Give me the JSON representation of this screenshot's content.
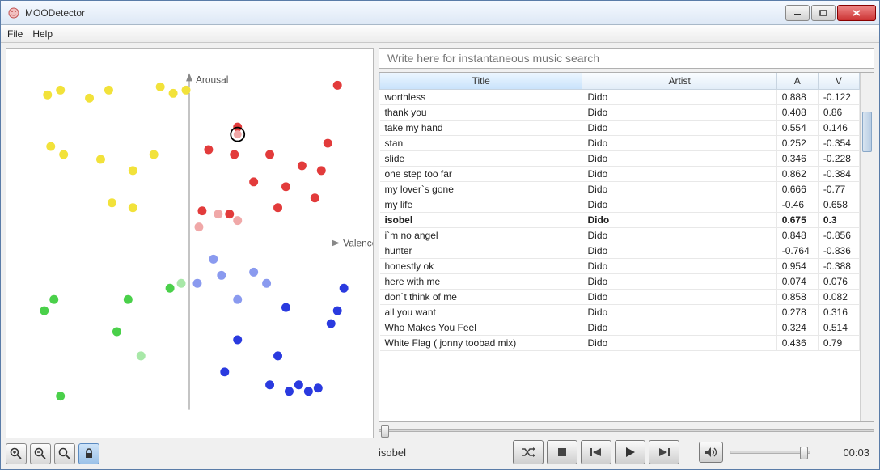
{
  "window": {
    "title": "MOODetector"
  },
  "menubar": {
    "file": "File",
    "help": "Help"
  },
  "search": {
    "placeholder": "Write here for instantaneous music search"
  },
  "columns": {
    "title": "Title",
    "artist": "Artist",
    "a": "A",
    "v": "V"
  },
  "selected_title": "isobel",
  "tracks": [
    {
      "title": "worthless",
      "artist": "Dido",
      "a": 0.888,
      "v": -0.122
    },
    {
      "title": "thank you",
      "artist": "Dido",
      "a": 0.408,
      "v": 0.86
    },
    {
      "title": "take my hand",
      "artist": "Dido",
      "a": 0.554,
      "v": 0.146
    },
    {
      "title": "stan",
      "artist": "Dido",
      "a": 0.252,
      "v": -0.354
    },
    {
      "title": "slide",
      "artist": "Dido",
      "a": 0.346,
      "v": -0.228
    },
    {
      "title": "one step too far",
      "artist": "Dido",
      "a": 0.862,
      "v": -0.384
    },
    {
      "title": "my lover`s gone",
      "artist": "Dido",
      "a": 0.666,
      "v": -0.77
    },
    {
      "title": "my life",
      "artist": "Dido",
      "a": -0.46,
      "v": 0.658
    },
    {
      "title": "isobel",
      "artist": "Dido",
      "a": 0.675,
      "v": 0.3
    },
    {
      "title": "i`m no angel",
      "artist": "Dido",
      "a": 0.848,
      "v": -0.856
    },
    {
      "title": "hunter",
      "artist": "Dido",
      "a": -0.764,
      "v": -0.836
    },
    {
      "title": "honestly ok",
      "artist": "Dido",
      "a": 0.954,
      "v": -0.388
    },
    {
      "title": "here with me",
      "artist": "Dido",
      "a": 0.074,
      "v": 0.076
    },
    {
      "title": "don`t think of me",
      "artist": "Dido",
      "a": 0.858,
      "v": 0.082
    },
    {
      "title": "all you want",
      "artist": "Dido",
      "a": 0.278,
      "v": 0.316
    },
    {
      "title": "Who Makes You Feel",
      "artist": "Dido",
      "a": 0.324,
      "v": 0.514
    },
    {
      "title": "White Flag ( jonny toobad mix)",
      "artist": "Dido",
      "a": 0.436,
      "v": 0.79
    }
  ],
  "player": {
    "now_playing": "isobel",
    "time": "00:03"
  },
  "chart_data": {
    "type": "scatter",
    "title": "",
    "xlabel": "Valence",
    "ylabel": "Arousal",
    "xlim": [
      -1,
      1
    ],
    "ylim": [
      -1,
      1
    ],
    "selected": {
      "x": 0.3,
      "y": 0.675
    },
    "series": [
      {
        "name": "quadrant-2-yellow",
        "color": "#f2e23a",
        "points": [
          {
            "x": -0.88,
            "y": 0.92
          },
          {
            "x": -0.8,
            "y": 0.95
          },
          {
            "x": -0.62,
            "y": 0.9
          },
          {
            "x": -0.5,
            "y": 0.95
          },
          {
            "x": -0.18,
            "y": 0.97
          },
          {
            "x": -0.1,
            "y": 0.93
          },
          {
            "x": -0.02,
            "y": 0.95
          },
          {
            "x": -0.86,
            "y": 0.6
          },
          {
            "x": -0.78,
            "y": 0.55
          },
          {
            "x": -0.55,
            "y": 0.52
          },
          {
            "x": -0.48,
            "y": 0.25
          },
          {
            "x": -0.35,
            "y": 0.45
          },
          {
            "x": -0.35,
            "y": 0.22
          },
          {
            "x": -0.22,
            "y": 0.55
          }
        ]
      },
      {
        "name": "quadrant-1-red",
        "color": "#e23b3b",
        "points": [
          {
            "x": 0.92,
            "y": 0.98
          },
          {
            "x": 0.86,
            "y": 0.62
          },
          {
            "x": 0.82,
            "y": 0.45
          },
          {
            "x": 0.78,
            "y": 0.28
          },
          {
            "x": 0.7,
            "y": 0.48
          },
          {
            "x": 0.6,
            "y": 0.35
          },
          {
            "x": 0.55,
            "y": 0.22
          },
          {
            "x": 0.5,
            "y": 0.55
          },
          {
            "x": 0.4,
            "y": 0.38
          },
          {
            "x": 0.3,
            "y": 0.72
          },
          {
            "x": 0.28,
            "y": 0.55
          },
          {
            "x": 0.25,
            "y": 0.18
          },
          {
            "x": 0.12,
            "y": 0.58
          },
          {
            "x": 0.08,
            "y": 0.2
          }
        ]
      },
      {
        "name": "quadrant-1-red-light",
        "color": "#f0a8a8",
        "points": [
          {
            "x": 0.3,
            "y": 0.14
          },
          {
            "x": 0.18,
            "y": 0.18
          },
          {
            "x": 0.06,
            "y": 0.1
          }
        ]
      },
      {
        "name": "quadrant-3-green",
        "color": "#4ad04a",
        "points": [
          {
            "x": -0.9,
            "y": -0.42
          },
          {
            "x": -0.84,
            "y": -0.35
          },
          {
            "x": -0.8,
            "y": -0.95
          },
          {
            "x": -0.45,
            "y": -0.55
          },
          {
            "x": -0.38,
            "y": -0.35
          },
          {
            "x": -0.12,
            "y": -0.28
          }
        ]
      },
      {
        "name": "quadrant-3-green-light",
        "color": "#a8e8a8",
        "points": [
          {
            "x": -0.3,
            "y": -0.7
          },
          {
            "x": -0.05,
            "y": -0.25
          }
        ]
      },
      {
        "name": "quadrant-4-blue",
        "color": "#2a3adf",
        "points": [
          {
            "x": 0.96,
            "y": -0.28
          },
          {
            "x": 0.92,
            "y": -0.42
          },
          {
            "x": 0.88,
            "y": -0.5
          },
          {
            "x": 0.8,
            "y": -0.9
          },
          {
            "x": 0.74,
            "y": -0.92
          },
          {
            "x": 0.68,
            "y": -0.88
          },
          {
            "x": 0.62,
            "y": -0.92
          },
          {
            "x": 0.6,
            "y": -0.4
          },
          {
            "x": 0.55,
            "y": -0.7
          },
          {
            "x": 0.5,
            "y": -0.88
          },
          {
            "x": 0.3,
            "y": -0.6
          },
          {
            "x": 0.22,
            "y": -0.8
          }
        ]
      },
      {
        "name": "quadrant-4-blue-light",
        "color": "#8a9aef",
        "points": [
          {
            "x": 0.48,
            "y": -0.25
          },
          {
            "x": 0.4,
            "y": -0.18
          },
          {
            "x": 0.3,
            "y": -0.35
          },
          {
            "x": 0.2,
            "y": -0.2
          },
          {
            "x": 0.15,
            "y": -0.1
          },
          {
            "x": 0.05,
            "y": -0.25
          }
        ]
      }
    ]
  }
}
